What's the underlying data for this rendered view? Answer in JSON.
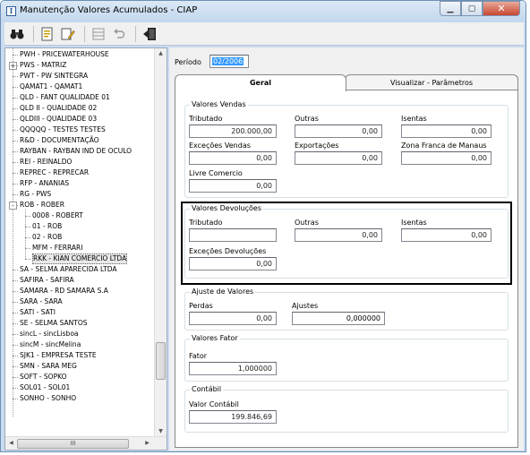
{
  "window": {
    "title": "Manutenção Valores Acumulados - CIAP"
  },
  "toolbar": {
    "icons": [
      "binoculars-icon",
      "report-icon",
      "edit-icon",
      "grid-icon",
      "undo-icon",
      "exit-icon"
    ]
  },
  "tree": {
    "items": [
      {
        "label": "PWH - PRICEWATERHOUSE",
        "level": 0
      },
      {
        "label": "PWS - MATRIZ",
        "level": 0,
        "expander": "+"
      },
      {
        "label": "PWT - PW SINTEGRA",
        "level": 0
      },
      {
        "label": "QAMAT1 - QAMAT1",
        "level": 0
      },
      {
        "label": "QLD - FANT QUALIDADE 01",
        "level": 0
      },
      {
        "label": "QLD II - QUALIDADE 02",
        "level": 0
      },
      {
        "label": "QLDIII - QUALIDADE 03",
        "level": 0
      },
      {
        "label": "QQQQQ - TESTES TESTES",
        "level": 0
      },
      {
        "label": "R&D - DOCUMENTAÇÃO",
        "level": 0
      },
      {
        "label": "RAYBAN - RAYBAN IND DE OCULO",
        "level": 0
      },
      {
        "label": "REI - REINALDO",
        "level": 0
      },
      {
        "label": "REPREC - REPRECAR",
        "level": 0
      },
      {
        "label": "RFP - ANANIAS",
        "level": 0
      },
      {
        "label": "RG - PWS",
        "level": 0
      },
      {
        "label": "ROB - ROBER",
        "level": 0,
        "expander": "-"
      },
      {
        "label": "0008 - ROBERT",
        "level": 1
      },
      {
        "label": "01 - ROB",
        "level": 1
      },
      {
        "label": "02 - ROB",
        "level": 1
      },
      {
        "label": "MFM - FERRARI",
        "level": 1
      },
      {
        "label": "RKK - KIAN COMERCIO LTDA",
        "level": 1,
        "selected": true
      },
      {
        "label": "SA - SELMA APARECIDA LTDA",
        "level": 0
      },
      {
        "label": "SAFIRA - SAFIRA",
        "level": 0
      },
      {
        "label": "SAMARA - RD SAMARA S.A",
        "level": 0
      },
      {
        "label": "SARA - SARA",
        "level": 0
      },
      {
        "label": "SATI - SATI",
        "level": 0
      },
      {
        "label": "SE - SELMA SANTOS",
        "level": 0
      },
      {
        "label": "sincL - sincLisboa",
        "level": 0
      },
      {
        "label": "sincM - sincMelina",
        "level": 0
      },
      {
        "label": "SJK1 - EMPRESA TESTE",
        "level": 0
      },
      {
        "label": "SMN - SARA MEG",
        "level": 0
      },
      {
        "label": "SOFT - SOPKO",
        "level": 0
      },
      {
        "label": "SOL01 - SOL01",
        "level": 0
      },
      {
        "label": "SONHO - SONHO",
        "level": 0
      }
    ],
    "hscroll_label": "III"
  },
  "periodo": {
    "label": "Período",
    "value": "02/2006"
  },
  "tabs": [
    {
      "label": "Geral",
      "active": true
    },
    {
      "label": "Visualizar - Parâmetros",
      "active": false
    }
  ],
  "vendas": {
    "title": "Valores Vendas",
    "tributado_label": "Tributado",
    "tributado": "200.000,00",
    "outras_label": "Outras",
    "outras": "0,00",
    "isentas_label": "Isentas",
    "isentas": "0,00",
    "excecoes_label": "Exceções Vendas",
    "excecoes": "0,00",
    "exportacoes_label": "Exportações",
    "exportacoes": "0,00",
    "zona_label": "Zona Franca de Manaus",
    "zona": "0,00",
    "livre_label": "Livre Comercio",
    "livre": "0,00"
  },
  "devolucoes": {
    "title": "Valores Devoluções",
    "tributado_label": "Tributado",
    "tributado": "",
    "outras_label": "Outras",
    "outras": "0,00",
    "isentas_label": "Isentas",
    "isentas": "0,00",
    "excecoes_label": "Exceções Devoluções",
    "excecoes": "0,00"
  },
  "ajuste": {
    "title": "Ajuste de Valores",
    "perdas_label": "Perdas",
    "perdas": "0,00",
    "ajustes_label": "Ajustes",
    "ajustes": "0,000000"
  },
  "fator": {
    "title": "Valores Fator",
    "fator_label": "Fator",
    "fator": "1,000000"
  },
  "contabil": {
    "title": "Contábil",
    "valor_label": "Valor Contábil",
    "valor": "199.846,69"
  }
}
